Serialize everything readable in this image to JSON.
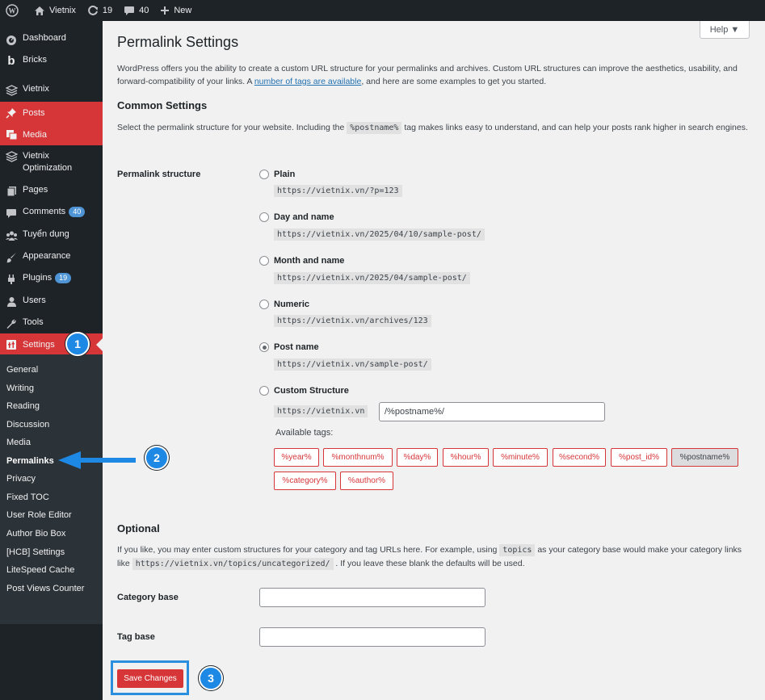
{
  "adminbar": {
    "site_name": "Vietnix",
    "updates_count": "19",
    "comments_count": "40",
    "new_label": "New"
  },
  "sidebar": {
    "items": [
      {
        "label": "Dashboard",
        "icon": "dashboard-icon"
      },
      {
        "label": "Bricks",
        "icon": "bricks-icon"
      },
      {
        "label": "Vietnix",
        "icon": "layers-icon"
      },
      {
        "label": "Posts",
        "icon": "pin-icon"
      },
      {
        "label": "Media",
        "icon": "media-icon"
      },
      {
        "label": "Vietnix Optimization",
        "icon": "layers-icon"
      },
      {
        "label": "Pages",
        "icon": "pages-icon"
      },
      {
        "label": "Comments",
        "icon": "comment-icon",
        "badge": "40"
      },
      {
        "label": "Tuyển dụng",
        "icon": "people-icon"
      },
      {
        "label": "Appearance",
        "icon": "brush-icon"
      },
      {
        "label": "Plugins",
        "icon": "plugin-icon",
        "badge": "19"
      },
      {
        "label": "Users",
        "icon": "user-icon"
      },
      {
        "label": "Tools",
        "icon": "wrench-icon"
      },
      {
        "label": "Settings",
        "icon": "settings-icon"
      }
    ],
    "submenu": [
      "General",
      "Writing",
      "Reading",
      "Discussion",
      "Media",
      "Permalinks",
      "Privacy",
      "Fixed TOC",
      "User Role Editor",
      "Author Bio Box",
      "[HCB] Settings",
      "LiteSpeed Cache",
      "Post Views Counter"
    ]
  },
  "header": {
    "title": "Permalink Settings",
    "help_label": "Help ▼"
  },
  "intro": {
    "text_before": "WordPress offers you the ability to create a custom URL structure for your permalinks and archives. Custom URL structures can improve the aesthetics, usability, and forward-compatibility of your links. A ",
    "link_text": "number of tags are available",
    "text_after": ", and here are some examples to get you started."
  },
  "common": {
    "heading": "Common Settings",
    "desc_before": "Select the permalink structure for your website. Including the ",
    "desc_code": "%postname%",
    "desc_after": " tag makes links easy to understand, and can help your posts rank higher in search engines.",
    "structure_label": "Permalink structure",
    "options": [
      {
        "label": "Plain",
        "example": "https://vietnix.vn/?p=123",
        "checked": false
      },
      {
        "label": "Day and name",
        "example": "https://vietnix.vn/2025/04/10/sample-post/",
        "checked": false
      },
      {
        "label": "Month and name",
        "example": "https://vietnix.vn/2025/04/sample-post/",
        "checked": false
      },
      {
        "label": "Numeric",
        "example": "https://vietnix.vn/archives/123",
        "checked": false
      },
      {
        "label": "Post name",
        "example": "https://vietnix.vn/sample-post/",
        "checked": true
      },
      {
        "label": "Custom Structure",
        "example": "",
        "checked": false
      }
    ],
    "custom_prefix": "https://vietnix.vn",
    "custom_value": "/%postname%/",
    "available_tags_label": "Available tags:",
    "tags": [
      "%year%",
      "%monthnum%",
      "%day%",
      "%hour%",
      "%minute%",
      "%second%",
      "%post_id%",
      "%postname%",
      "%category%",
      "%author%"
    ],
    "active_tag": "%postname%"
  },
  "optional": {
    "heading": "Optional",
    "desc_1": "If you like, you may enter custom structures for your category and tag URLs here. For example, using ",
    "desc_code_1": "topics",
    "desc_2": " as your category base would make your category links like ",
    "desc_code_2": "https://vietnix.vn/topics/uncategorized/",
    "desc_3": " . If you leave these blank the defaults will be used.",
    "category_label": "Category base",
    "category_value": "",
    "tag_label": "Tag base",
    "tag_value": ""
  },
  "save_label": "Save Changes",
  "steps": [
    "1",
    "2",
    "3"
  ],
  "colors": {
    "accent_red": "#d63638",
    "annotation_blue": "#1e88e5",
    "sidebar_bg": "#1d2327"
  }
}
